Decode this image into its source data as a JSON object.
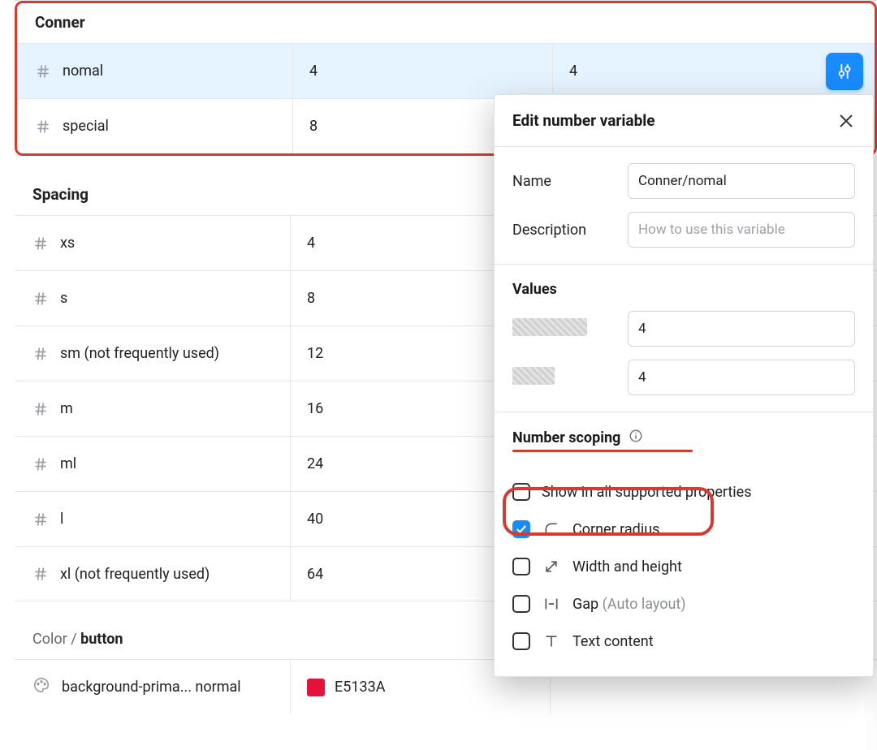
{
  "sections": {
    "conner": {
      "title": "Conner",
      "rows": [
        {
          "name": "nomal",
          "v1": "4",
          "v2": "4",
          "selected": true
        },
        {
          "name": "special",
          "v1": "8",
          "v2": ""
        }
      ]
    },
    "spacing": {
      "title": "Spacing",
      "rows": [
        {
          "name": "xs",
          "v1": "4"
        },
        {
          "name": "s",
          "v1": "8"
        },
        {
          "name": "sm (not frequently used)",
          "v1": "12"
        },
        {
          "name": "m",
          "v1": "16"
        },
        {
          "name": "ml",
          "v1": "24"
        },
        {
          "name": "l",
          "v1": "40"
        },
        {
          "name": "xl (not frequently used)",
          "v1": "64"
        }
      ]
    },
    "color_section": {
      "path_prefix": "Color / ",
      "path_current": "button",
      "rows": [
        {
          "name": "background-prima... normal",
          "hex": "E5133A",
          "swatch": "#e5133a"
        }
      ]
    }
  },
  "popover": {
    "title": "Edit number variable",
    "name_label": "Name",
    "name_value": "Conner/nomal",
    "desc_label": "Description",
    "desc_placeholder": "How to use this variable",
    "values_title": "Values",
    "values": [
      {
        "value": "4"
      },
      {
        "value": "4"
      }
    ],
    "scoping_title": "Number scoping",
    "scoping_options": [
      {
        "id": "all",
        "label": "Show in all supported properties",
        "checked": false,
        "icon": null
      },
      {
        "id": "corner",
        "label": "Corner radius",
        "checked": true,
        "icon": "corner"
      },
      {
        "id": "wh",
        "label": "Width and height",
        "checked": false,
        "icon": "resize"
      },
      {
        "id": "gap",
        "label": "Gap",
        "hint": "(Auto layout)",
        "checked": false,
        "icon": "gap"
      },
      {
        "id": "text",
        "label": "Text content",
        "checked": false,
        "icon": "text"
      }
    ]
  },
  "icons": {
    "edit_variable": "sliders-icon"
  }
}
